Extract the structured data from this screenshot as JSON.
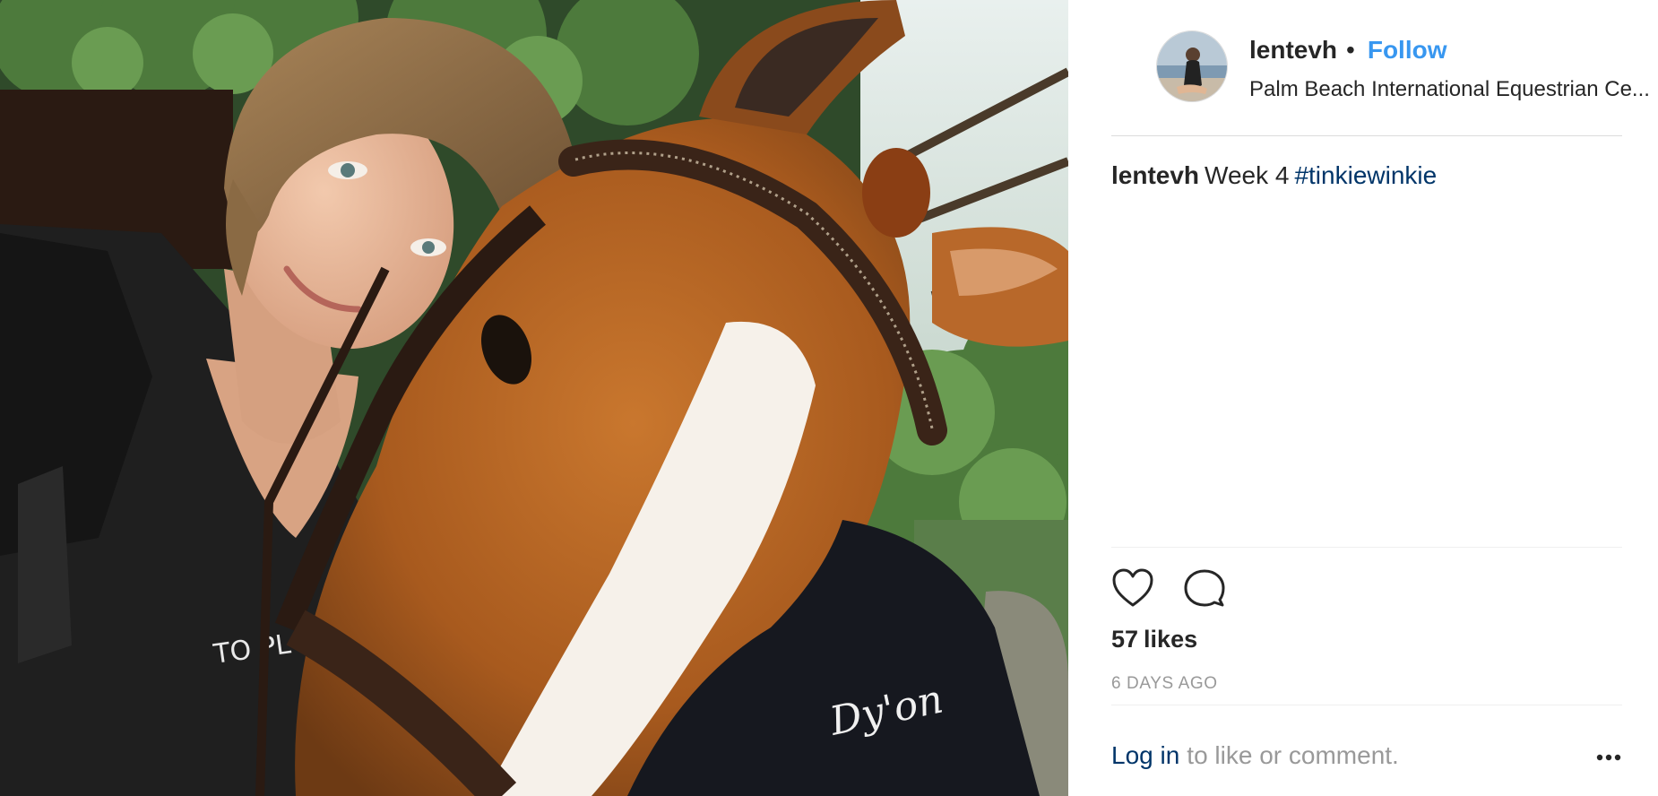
{
  "post": {
    "photo_alt": "selfie of a woman with a chestnut horse",
    "photo_print": "TO PL",
    "photo_logo": "Dy'on"
  },
  "header": {
    "avatar_icon": "user-avatar-icon",
    "username": "lentevh",
    "separator": "•",
    "follow_label": "Follow",
    "location": "Palm Beach International Equestrian Ce..."
  },
  "caption": {
    "username": "lentevh",
    "text": "Week 4",
    "hashtag": "#tinkiewinkie"
  },
  "actions": {
    "like_icon": "heart-icon",
    "comment_icon": "comment-bubble-icon",
    "more_icon": "more-options-icon"
  },
  "stats": {
    "likes_count": "57",
    "likes_word": "likes",
    "timestamp": "6 DAYS AGO"
  },
  "footer": {
    "login_link": "Log in",
    "login_rest": "to like or comment."
  },
  "colors": {
    "link_blue": "#3897f0",
    "hashtag_navy": "#003569",
    "muted_gray": "#999999",
    "text_dark": "#262626",
    "divider": "#dbdbdb"
  }
}
